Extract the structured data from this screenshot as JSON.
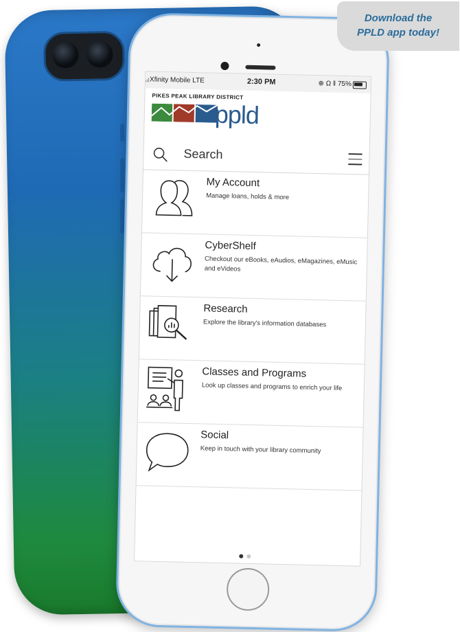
{
  "badge": {
    "line1": "Download the",
    "line2": "PPLD app today!"
  },
  "status_bar": {
    "carrier": "Xfinity Mobile  LTE",
    "time": "2:30 PM",
    "right": "⊕ Ω ‖ 75%"
  },
  "header": {
    "district": "PIKES PEAK LIBRARY DISTRICT",
    "logo_text": "ppld"
  },
  "search": {
    "label": "Search"
  },
  "menu_items": [
    {
      "title": "My Account",
      "description": "Manage loans, holds & more",
      "icon": "users-icon"
    },
    {
      "title": "CyberShelf",
      "description": "Checkout our eBooks, eAudios, eMagazines, eMusic and eVideos",
      "icon": "cloud-download-icon"
    },
    {
      "title": "Research",
      "description": "Explore the library's information databases",
      "icon": "research-icon"
    },
    {
      "title": "Classes and Programs",
      "description": "Look up classes and programs to enrich your life",
      "icon": "classroom-icon"
    },
    {
      "title": "Social",
      "description": "Keep in touch with your library community",
      "icon": "speech-bubble-icon"
    }
  ],
  "pagination": {
    "active": 1,
    "total": 2
  },
  "colors": {
    "logo_blue": "#2a5b8e",
    "logo_green": "#3b8a3e",
    "logo_red": "#a23a2a",
    "badge_text": "#2a6c9a"
  }
}
